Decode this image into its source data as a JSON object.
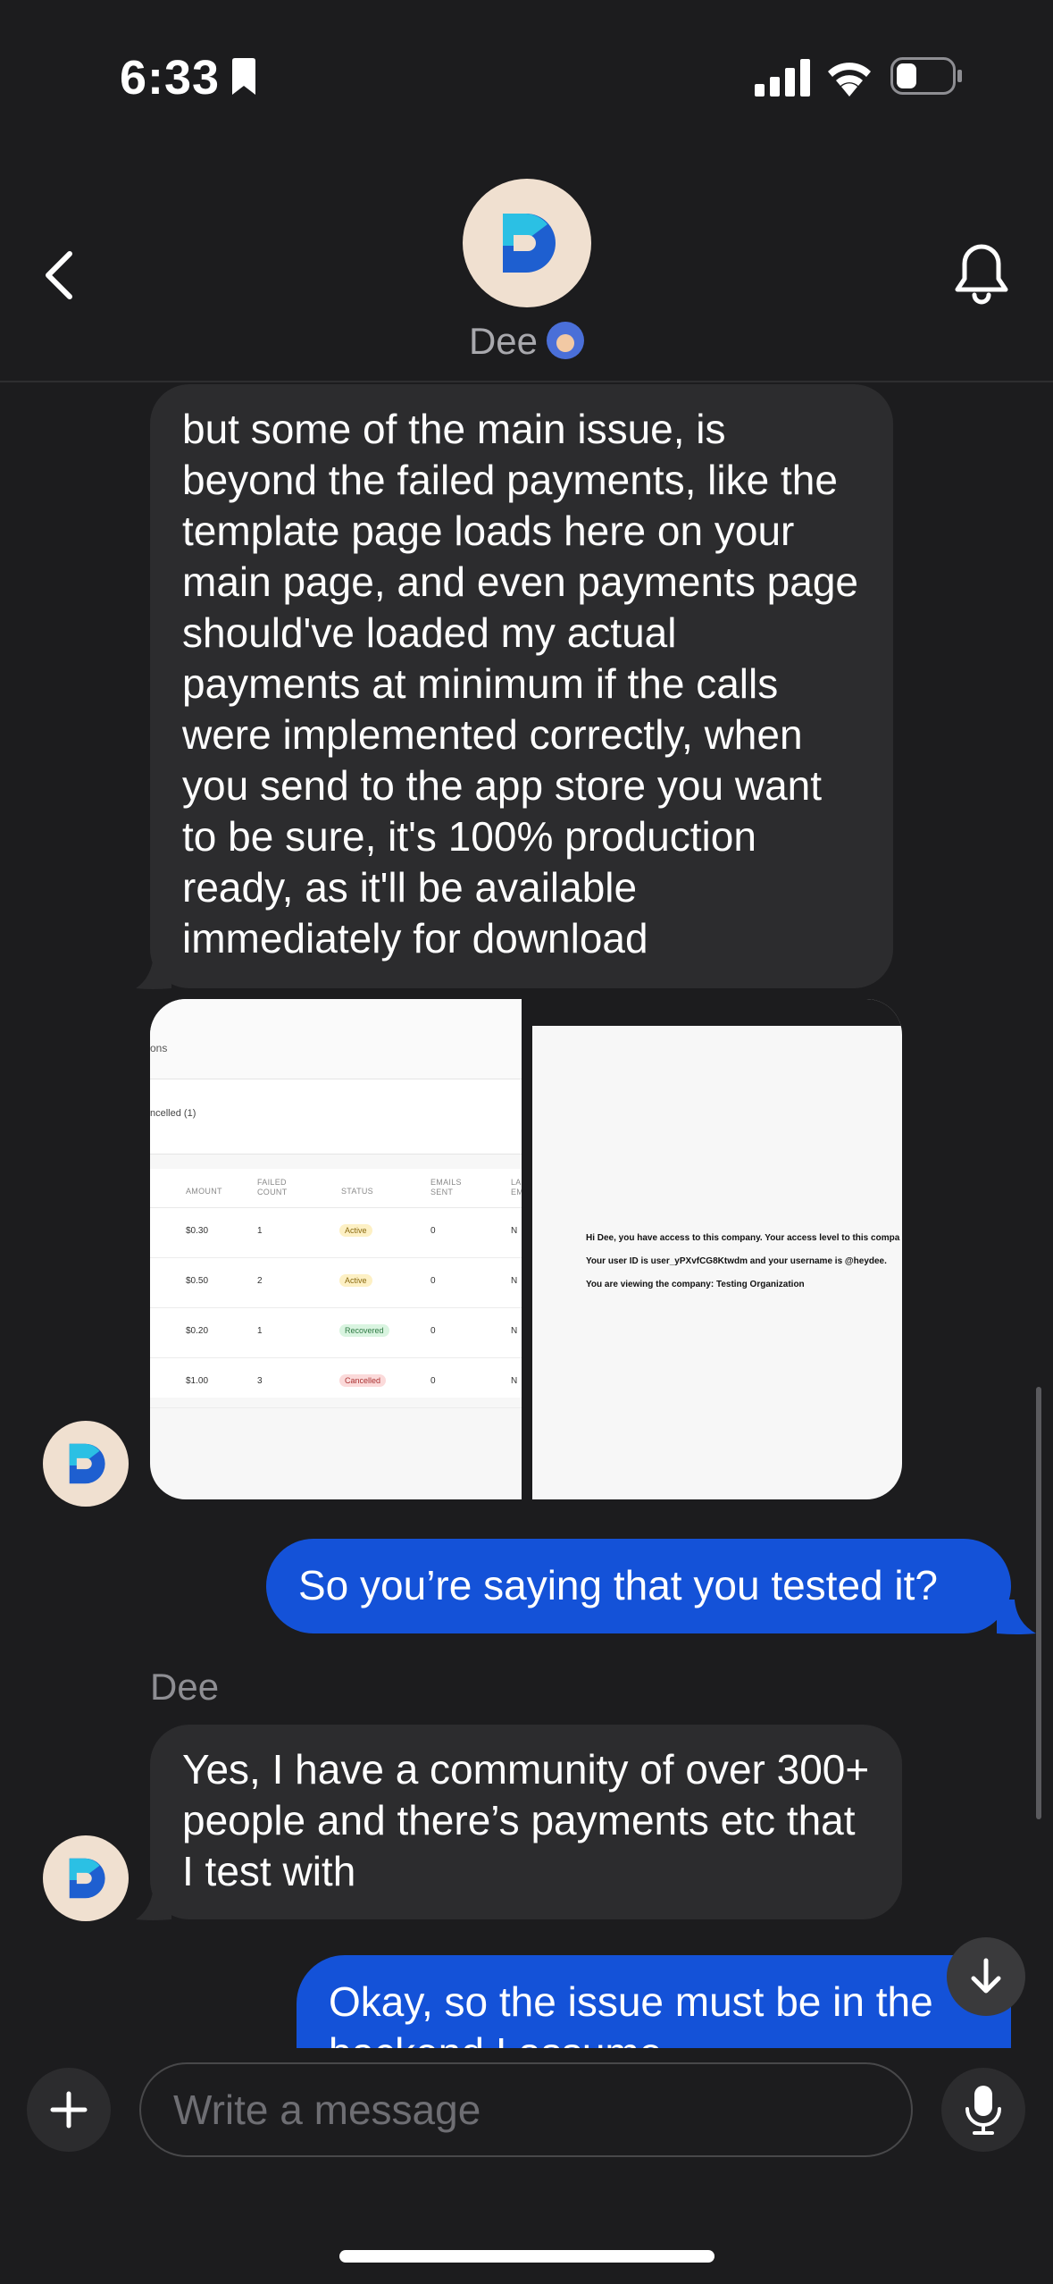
{
  "status_bar": {
    "time": "6:33"
  },
  "header": {
    "contact_name": "Dee"
  },
  "messages": [
    {
      "direction": "incoming",
      "text": "but some of the main issue, is beyond the failed payments, like the template page loads here on your main page, and even payments page should've loaded my actual payments at minimum if the calls were implemented correctly, when you send to the app store you want to be sure, it's 100% production ready, as it'll be available immediately for download"
    },
    {
      "direction": "outgoing",
      "text": "So you’re saying that you tested it?"
    },
    {
      "direction": "incoming",
      "sender": "Dee",
      "text": "Yes, I have a community of over 300+ people and there’s payments etc that I test with"
    },
    {
      "direction": "outgoing",
      "text": "Okay, so the issue must be in the backend I assume"
    }
  ],
  "attachment_a": {
    "tab_fragment": "ons",
    "filter_fragment": "ncelled (1)",
    "columns": [
      "AMOUNT",
      "FAILED COUNT",
      "STATUS",
      "EMAILS SENT",
      "LA EM"
    ],
    "rows": [
      {
        "amount": "$0.30",
        "failed": "1",
        "status": "Active",
        "emails": "0",
        "last": "N"
      },
      {
        "amount": "$0.50",
        "failed": "2",
        "status": "Active",
        "emails": "0",
        "last": "N"
      },
      {
        "amount": "$0.20",
        "failed": "1",
        "status": "Recovered",
        "emails": "0",
        "last": "N"
      },
      {
        "amount": "$1.00",
        "failed": "3",
        "status": "Cancelled",
        "emails": "0",
        "last": "N"
      }
    ]
  },
  "attachment_b": {
    "line1": "Hi Dee, you have access to this company. Your access level to this compa",
    "line2": "Your user ID is user_yPXvfCG8Ktwdm and your username is @heydee.",
    "line3": "You are viewing the company: Testing Organization"
  },
  "composer": {
    "placeholder": "Write a message"
  },
  "colors": {
    "outgoing_bubble": "#1452d8",
    "incoming_bubble": "#2c2c2e",
    "background": "#1c1c1e",
    "avatar_bg": "#f0e0d0"
  },
  "icons": [
    "bookmark-icon",
    "signal-icon",
    "wifi-icon",
    "battery-icon",
    "back-chevron-icon",
    "bell-icon",
    "plus-icon",
    "mic-icon",
    "arrow-down-icon"
  ]
}
